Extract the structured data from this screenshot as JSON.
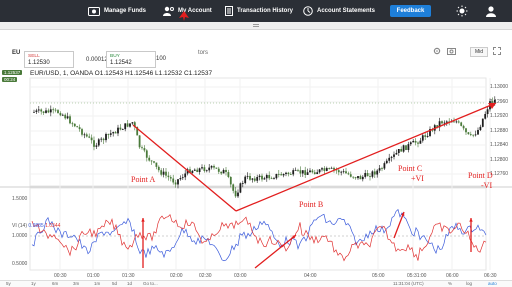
{
  "nav": {
    "manage_funds": "Manage Funds",
    "my_account": "My Account",
    "transaction_history": "Transaction History",
    "account_statements": "Account Statements",
    "feedback": "Feedback"
  },
  "toolbar": {
    "instrument_short": "EU",
    "sell_label": "SELL",
    "sell_value": "1.12530",
    "buy_label": "BUY",
    "buy_value": "1.12542",
    "spread": "0.00012",
    "quantity": "100",
    "indicators": "tors",
    "timeframe": "Mid"
  },
  "legend": {
    "instrument": "EUR/USD, 1, OANDA",
    "ohlc": "O1.12543 H1.12546 L1.12532 C1.12537",
    "vi_label": "VI (14)",
    "vi_plus": "0.9885",
    "vi_minus": "1.0344"
  },
  "price_ticks": [
    "1.13000",
    "1.12960",
    "1.12920",
    "1.12880",
    "1.12840",
    "1.12800",
    "1.12760"
  ],
  "price_tag": "1.12537",
  "vi_ticks": [
    "1.5000",
    "1.0000",
    "0.5000"
  ],
  "time_ticks": [
    "00:30",
    "01:00",
    "01:30",
    "02:00",
    "02:30",
    "03:00",
    "04:00",
    "05:00",
    "05:31:00",
    "06:00",
    "06:30"
  ],
  "bottom_bar": {
    "ranges": [
      "5y",
      "1y",
      "6m",
      "3m",
      "1m",
      "5d",
      "1d",
      "Go to..."
    ],
    "clock": "11:31:04 (UTC)",
    "scale": [
      "%",
      "log",
      "auto"
    ]
  },
  "annotations": {
    "point_a": "Point A",
    "point_b": "Point B",
    "point_c": "Point C",
    "point_c_sub": "+VI",
    "point_d": "Point D",
    "point_d_sub": "-VI"
  },
  "colors": {
    "candle_up": "#1c1c1c",
    "candle_down": "#4a7a3a",
    "vi_plus": "#3b5bdb",
    "vi_minus": "#e03131",
    "annotation": "#e21e1e",
    "nav_bg": "#2b2f36",
    "feedback_bg": "#1e7fd9"
  },
  "icons": [
    "manage-funds-icon",
    "my-account-icon",
    "transaction-history-icon",
    "account-statements-icon",
    "brightness-icon",
    "user-icon"
  ]
}
